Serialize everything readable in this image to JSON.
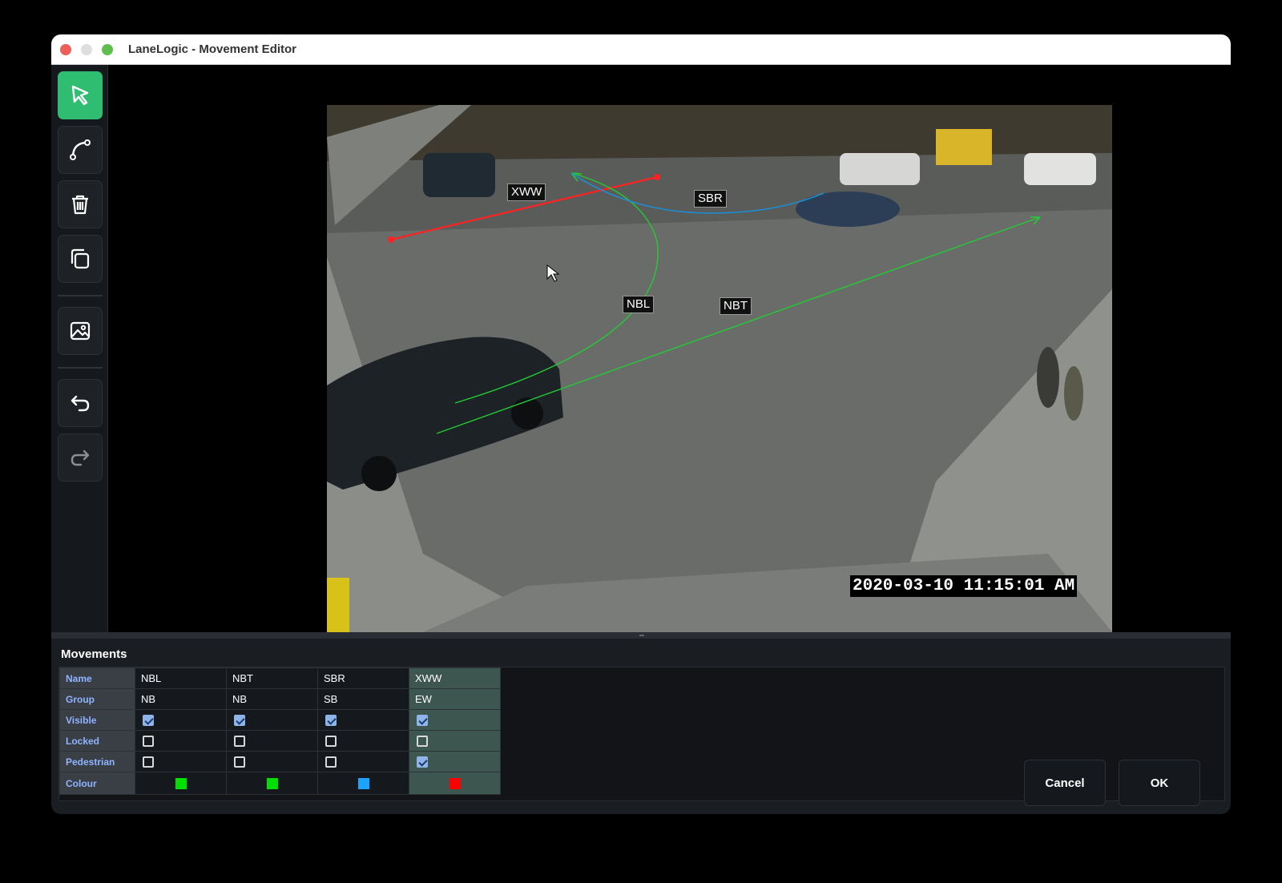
{
  "window": {
    "title": "LaneLogic - Movement Editor"
  },
  "toolbar": {
    "tools": [
      {
        "icon": "select-arrow-icon",
        "active": true
      },
      {
        "icon": "curve-path-icon",
        "active": false
      },
      {
        "icon": "trash-icon",
        "active": false
      },
      {
        "icon": "copy-icon",
        "active": false
      },
      {
        "icon": "image-icon",
        "active": false
      },
      {
        "icon": "undo-icon",
        "active": false
      },
      {
        "icon": "redo-icon",
        "active": false
      }
    ]
  },
  "video": {
    "timestamp": "2020-03-10 11:15:01 AM",
    "labels": {
      "xww": "XWW",
      "sbr": "SBR",
      "nbl": "NBL",
      "nbt": "NBT"
    }
  },
  "movements": {
    "title": "Movements",
    "row_headers": {
      "name": "Name",
      "group": "Group",
      "visible": "Visible",
      "locked": "Locked",
      "pedestrian": "Pedestrian",
      "colour": "Colour"
    },
    "columns": [
      {
        "name": "NBL",
        "group": "NB",
        "visible": true,
        "locked": false,
        "pedestrian": false,
        "colour": "#00e000",
        "selected": false
      },
      {
        "name": "NBT",
        "group": "NB",
        "visible": true,
        "locked": false,
        "pedestrian": false,
        "colour": "#00e000",
        "selected": false
      },
      {
        "name": "SBR",
        "group": "SB",
        "visible": true,
        "locked": false,
        "pedestrian": false,
        "colour": "#1aa3ff",
        "selected": false
      },
      {
        "name": "XWW",
        "group": "EW",
        "visible": true,
        "locked": false,
        "pedestrian": true,
        "colour": "#ff0000",
        "selected": true
      }
    ]
  },
  "buttons": {
    "cancel": "Cancel",
    "ok": "OK"
  },
  "colors": {
    "active_tool": "#2fbe71",
    "selected_column": "#3d5650",
    "header_text": "#8fb4ff"
  }
}
